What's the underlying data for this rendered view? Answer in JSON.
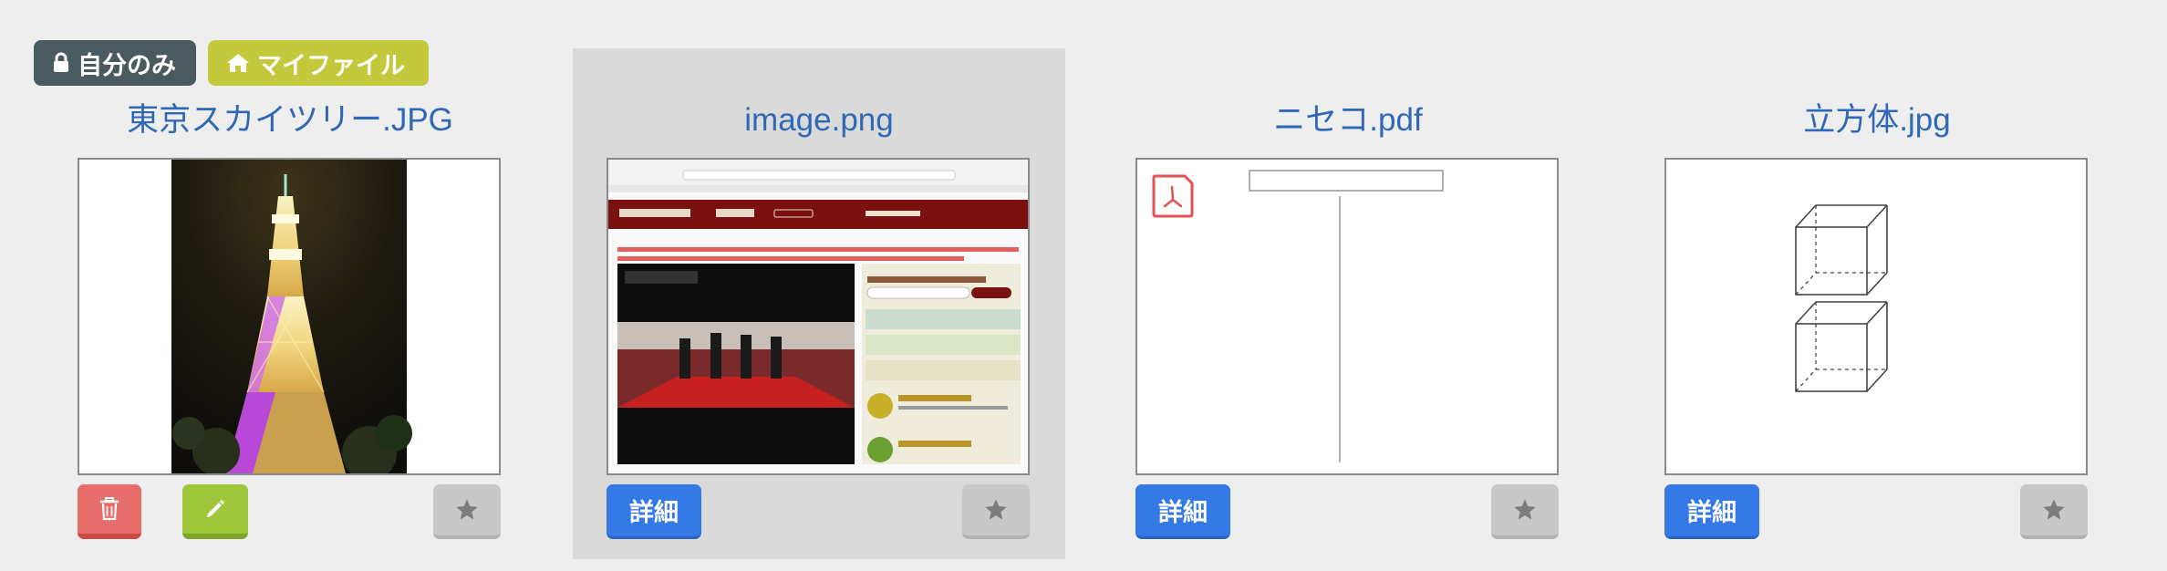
{
  "badges": {
    "private_label": "自分のみ",
    "myfile_label": "マイファイル"
  },
  "files": [
    {
      "name": "東京スカイツリー.JPG"
    },
    {
      "name": "image.png"
    },
    {
      "name": "ニセコ.pdf"
    },
    {
      "name": "立方体.jpg"
    }
  ],
  "actions": {
    "detail_label": "詳細"
  },
  "colors": {
    "title": "#3068b8",
    "detail_button": "#3579e6",
    "delete_button": "#e66d6a",
    "edit_button": "#9ec73c",
    "star_button": "#c8c8c8",
    "badge_private": "#4a5a5e",
    "badge_myfile": "#c3c83c"
  },
  "icons": [
    "lock-icon",
    "home-icon",
    "trash-icon",
    "pencil-icon",
    "star-icon",
    "pdf-icon"
  ]
}
